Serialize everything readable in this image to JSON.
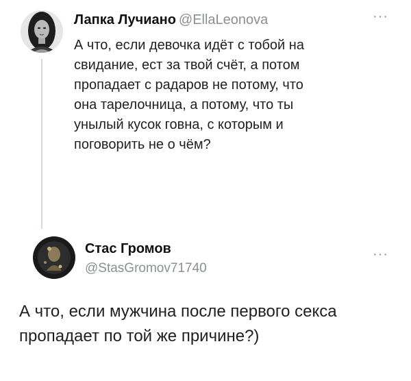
{
  "tweets": [
    {
      "author_name": "Лапка Лучиано",
      "author_handle": "@EllaLeonova",
      "more_label": "···",
      "text": "А что, если девочка идёт с тобой на\nсвидание, ест за твой счёт, а потом\nпропадает с радаров не потому, что\nона тарелочница, а потому, что ты\nунылый кусок говна, с которым и\nпоговорить не о чём?"
    },
    {
      "author_name": "Стас Громов",
      "author_handle": "@StasGromov71740",
      "more_label": "···",
      "text": "А что, если мужчина после первого секса\nпропадает по той же причине?)"
    }
  ],
  "icons": {
    "more": "more-options-icon",
    "avatar1": "user-avatar",
    "avatar2": "user-avatar"
  },
  "colors": {
    "background": "#ffffff",
    "text": "#1b1b1b",
    "secondary_text": "#8a8f94",
    "thread_line": "#cfd9de"
  }
}
